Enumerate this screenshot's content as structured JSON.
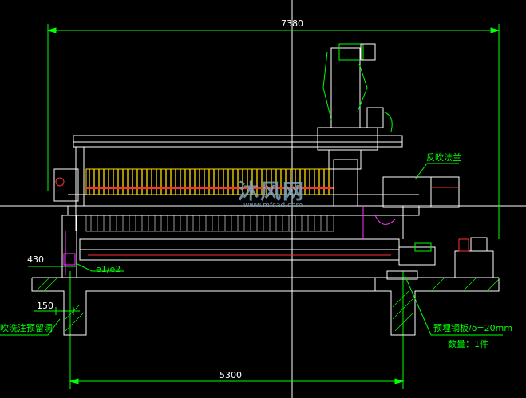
{
  "dimensions": {
    "overall_length": "7380",
    "lower_length": "5300",
    "left_offset": "430",
    "left_width": "150"
  },
  "labels": {
    "backwash_flange": "反吹法兰",
    "pipe_label": "e1/e2",
    "embedded_plate": "预埋钢板/δ=20mm",
    "quantity": "数量：1件",
    "left_note": "吹洗注预留洞"
  },
  "watermark": {
    "text": "沐风网",
    "url": "www.mfcad.com"
  },
  "colors": {
    "background": "#000000",
    "line_white": "#ffffff",
    "line_green": "#00ff00",
    "filter_plates": "#ffdd00",
    "accent_magenta": "#ff33ff",
    "accent_red": "#ff3030",
    "cyan": "#00ffff"
  }
}
